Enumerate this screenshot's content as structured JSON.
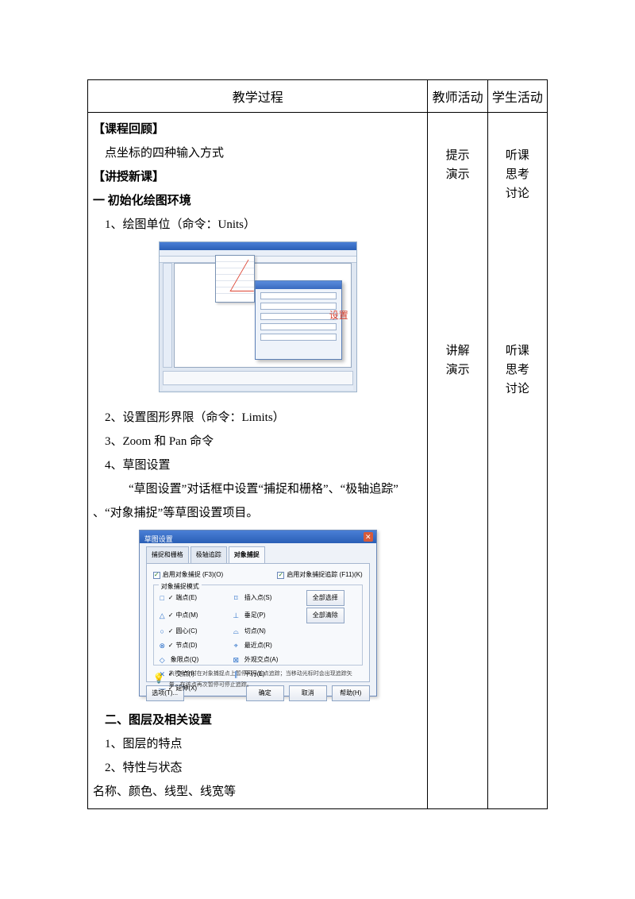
{
  "header": {
    "col_main": "教学过程",
    "col_teacher": "教师活动",
    "col_student": "学生活动"
  },
  "content": {
    "review_h": "【课程回顾】",
    "review_1": "点坐标的四种输入方式",
    "new_h": "【讲授新课】",
    "sec1_h": "一  初始化绘图环境",
    "sec1_1": "1、绘图单位（命令：Units）",
    "sec1_2": "2、设置图形界限（命令：Limits）",
    "sec1_3": "3、Zoom 和 Pan 命令",
    "sec1_4": "4、草图设置",
    "sec1_4_desc_a": "“草图设置”对话框中设置“捕捉和栅格”、“极轴追踪”",
    "sec1_4_desc_b": "、“对象捕捉”等草图设置项目。",
    "sec2_h": "二、图层及相关设置",
    "sec2_1": "1、图层的特点",
    "sec2_2": "2、特性与状态",
    "sec2_3": "名称、颜色、线型、线宽等"
  },
  "side": {
    "t1": "提示\n演示",
    "s1": "听课\n思考\n讨论",
    "t2": "讲解\n演示",
    "s2": "听课\n思考\n讨论"
  },
  "ss1": {
    "label": "设置"
  },
  "ss2": {
    "title": "草图设置",
    "tabs": [
      "捕捉和栅格",
      "极轴追踪",
      "对象捕捉"
    ],
    "top_left": "启用对象捕捉 (F3)(O)",
    "top_right": "启用对象捕捉追踪 (F11)(K)",
    "group_title": "对象捕捉模式",
    "opts_col1": [
      "端点(E)",
      "中点(M)",
      "圆心(C)",
      "节点(D)",
      "象限点(Q)",
      "交点(I)",
      "延伸(X)"
    ],
    "opts_col2": [
      "插入点(S)",
      "垂足(P)",
      "切点(N)",
      "最近点(R)",
      "外观交点(A)",
      "平行(L)"
    ],
    "btn_selectall": "全部选择",
    "btn_clearall": "全部清除",
    "tip": "执行命令时在对象捕捉点上暂停可从该点追踪；当移动光标时会出现追踪矢量，在该点再次暂停可停止追踪。",
    "btn_options": "选项(T)...",
    "btn_ok": "确定",
    "btn_cancel": "取消",
    "btn_help": "帮助(H)"
  }
}
